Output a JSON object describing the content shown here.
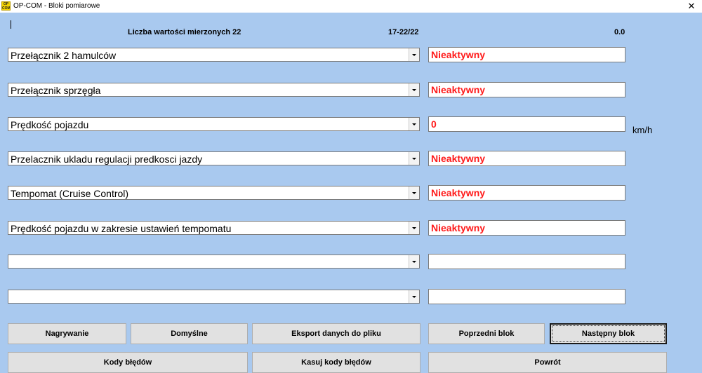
{
  "window": {
    "title": "OP-COM - Bloki pomiarowe",
    "icon_text": "OP COM",
    "close_glyph": "✕"
  },
  "header": {
    "count_label": "Liczba wartości mierzonych 22",
    "range": "17-22/22",
    "time_value": "0.0"
  },
  "rows": [
    {
      "parameter": "Przełącznik 2 hamulców",
      "value": "Nieaktywny",
      "unit": ""
    },
    {
      "parameter": "Przełącznik sprzęgła",
      "value": "Nieaktywny",
      "unit": ""
    },
    {
      "parameter": "Prędkość pojazdu",
      "value": "0",
      "unit": "km/h"
    },
    {
      "parameter": "Przelacznik ukladu regulacji predkosci jazdy",
      "value": "Nieaktywny",
      "unit": ""
    },
    {
      "parameter": "Tempomat (Cruise Control)",
      "value": "Nieaktywny",
      "unit": ""
    },
    {
      "parameter": "Prędkość pojazdu w zakresie ustawień tempomatu",
      "value": "Nieaktywny",
      "unit": ""
    },
    {
      "parameter": "",
      "value": "",
      "unit": ""
    },
    {
      "parameter": "",
      "value": "",
      "unit": ""
    }
  ],
  "buttons": {
    "record": "Nagrywanie",
    "defaults": "Domyślne",
    "export": "Eksport danych do pliku",
    "prev_block": "Poprzedni blok",
    "next_block": "Następny blok",
    "error_codes": "Kody błędów",
    "clear_codes": "Kasuj kody błędów",
    "back": "Powrót"
  },
  "colors": {
    "background": "#a9c9ef",
    "value_text": "#ff1a1a"
  }
}
